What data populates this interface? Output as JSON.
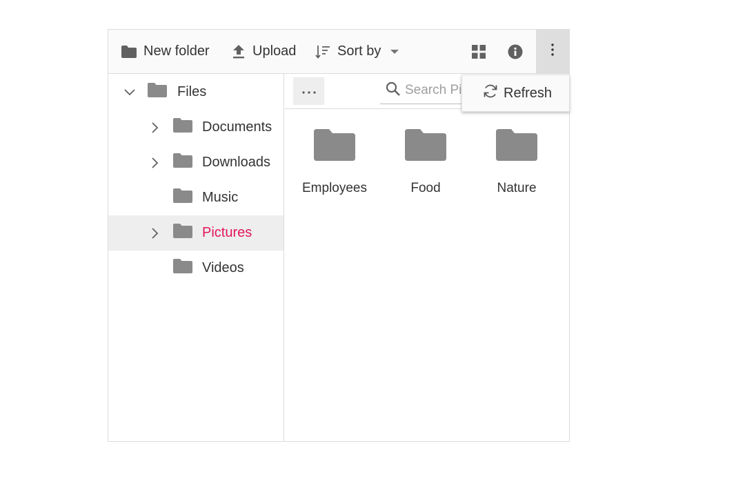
{
  "toolbar": {
    "new_folder": "New folder",
    "upload": "Upload",
    "sort_by": "Sort by"
  },
  "tree": {
    "root": "Files",
    "items": [
      {
        "label": "Documents",
        "expandable": true
      },
      {
        "label": "Downloads",
        "expandable": true
      },
      {
        "label": "Music",
        "expandable": false
      },
      {
        "label": "Pictures",
        "expandable": true,
        "selected": true
      },
      {
        "label": "Videos",
        "expandable": false
      }
    ]
  },
  "address": {
    "search_placeholder": "Search Pictures"
  },
  "files": [
    {
      "name": "Employees"
    },
    {
      "name": "Food"
    },
    {
      "name": "Nature"
    }
  ],
  "popup": {
    "refresh": "Refresh"
  },
  "colors": {
    "accent": "#e3165b",
    "folder": "#8a8a8a",
    "icon": "#616161"
  }
}
